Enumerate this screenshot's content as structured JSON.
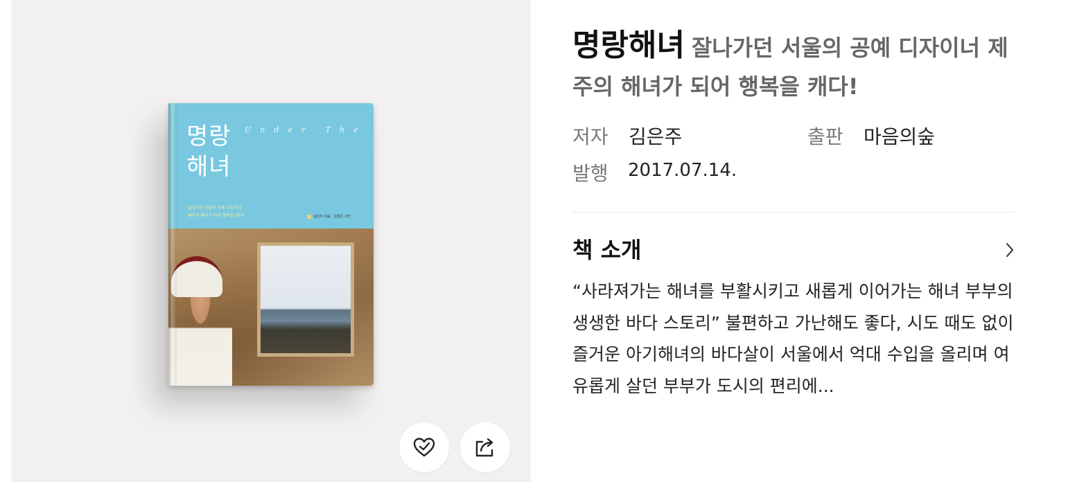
{
  "book": {
    "title": "명랑해녀",
    "subtitle": "잘나가던 서울의 공예 디자이너 제주의 해녀가 되어 행복을 캐다!",
    "meta": {
      "author_label": "저자",
      "author": "김은주",
      "publisher_label": "출판",
      "publisher": "마음의숲",
      "date_label": "발행",
      "date": "2017.07.14."
    }
  },
  "cover": {
    "title_line1": "명랑",
    "title_line2": "해녀",
    "english_title": "Under The Sea",
    "sub_line1": "잘나가던 서울의 공예 디자이너",
    "sub_line2": "제주의 해녀가 되어 행복을 캐다!",
    "author": "김은주 지음 · 김형준 사진"
  },
  "intro": {
    "heading": "책 소개",
    "text": "“사라져가는 해녀를 부활시키고 새롭게 이어가는 해녀 부부의 생생한 바다 스토리” 불편하고 가난해도 좋다, 시도 때도 없이 즐거운 아기해녀의 바다살이 서울에서 억대 수입을 올리며 여유롭게 살던 부부가 도시의 편리에..."
  },
  "actions": {
    "like_icon": "heart-check-icon",
    "share_icon": "share-icon"
  },
  "colors": {
    "left_panel_bg": "#f2f1f0",
    "cover_sky": "#79c8e0",
    "title_text": "#111111",
    "subtitle_text": "#666666"
  }
}
